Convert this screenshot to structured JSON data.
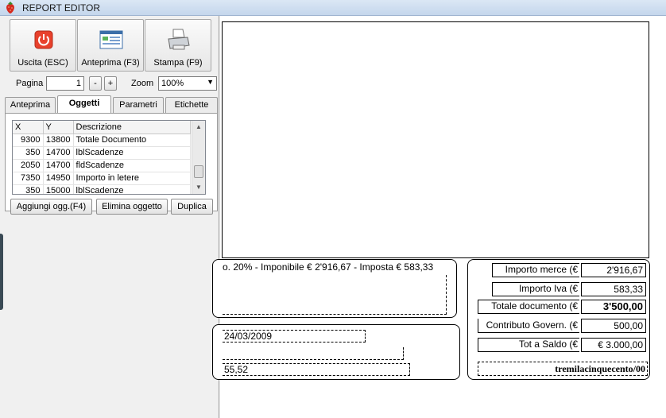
{
  "window": {
    "title": "REPORT EDITOR"
  },
  "toolbar": {
    "exit_label": "Uscita (ESC)",
    "preview_label": "Anteprima (F3)",
    "print_label": "Stampa (F9)",
    "page_label": "Pagina",
    "page_value": "1",
    "minus_label": "-",
    "plus_label": "+",
    "zoom_label": "Zoom",
    "zoom_value": "100%"
  },
  "tabs": [
    {
      "label": "Anteprima"
    },
    {
      "label": "Oggetti"
    },
    {
      "label": "Parametri"
    },
    {
      "label": "Etichette"
    }
  ],
  "grid": {
    "columns": [
      "X",
      "Y",
      "Descrizione"
    ],
    "rows": [
      [
        "9300",
        "13800",
        "Totale Documento"
      ],
      [
        "350",
        "14700",
        "lblScadenze"
      ],
      [
        "2050",
        "14700",
        "fldScadenze"
      ],
      [
        "7350",
        "14950",
        "Importo in letere"
      ],
      [
        "350",
        "15000",
        "lblScadenze"
      ]
    ]
  },
  "actions": {
    "add_label": "Aggiungi ogg.(F4)",
    "delete_label": "Elimina oggetto",
    "duplicate_label": "Duplica"
  },
  "report": {
    "iva_line": "o. 20% - Imponibile € 2'916,67 - Imposta € 583,33",
    "date": "24/03/2009",
    "partial_amount": "55,52",
    "totals": [
      {
        "label": "Importo merce (€",
        "value": "2'916,67",
        "bold": false
      },
      {
        "label": "Importo Iva (€",
        "value": "583,33",
        "bold": false
      },
      {
        "label": "Totale documento (€",
        "value": "3'500,00",
        "bold": true
      },
      {
        "label": "Contributo Govern. (€",
        "value": "500,00",
        "bold": false
      },
      {
        "label": "Tot a Saldo (€",
        "value": "€ 3.000,00",
        "bold": false
      }
    ],
    "amount_in_words": "tremilacinquecento/00"
  },
  "colors": {
    "titlebar": "#c4d6ec",
    "exit_icon": "#e8412c"
  }
}
